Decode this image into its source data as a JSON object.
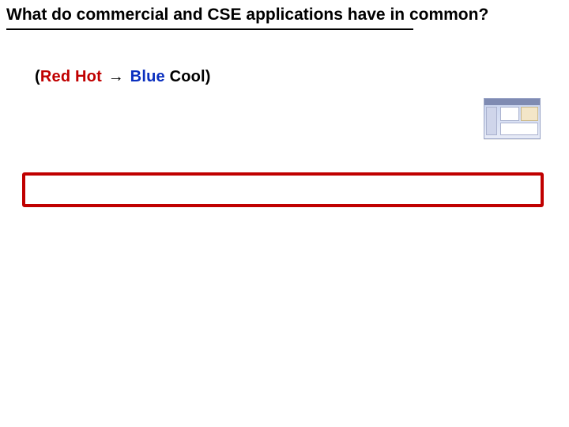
{
  "title": "What  do commercial and CSE applications have in common?",
  "subhead": {
    "open": "(",
    "red": "Red Hot",
    "arrow": "→",
    "blue": "Blue",
    "tail": " Cool)",
    "close": ""
  }
}
